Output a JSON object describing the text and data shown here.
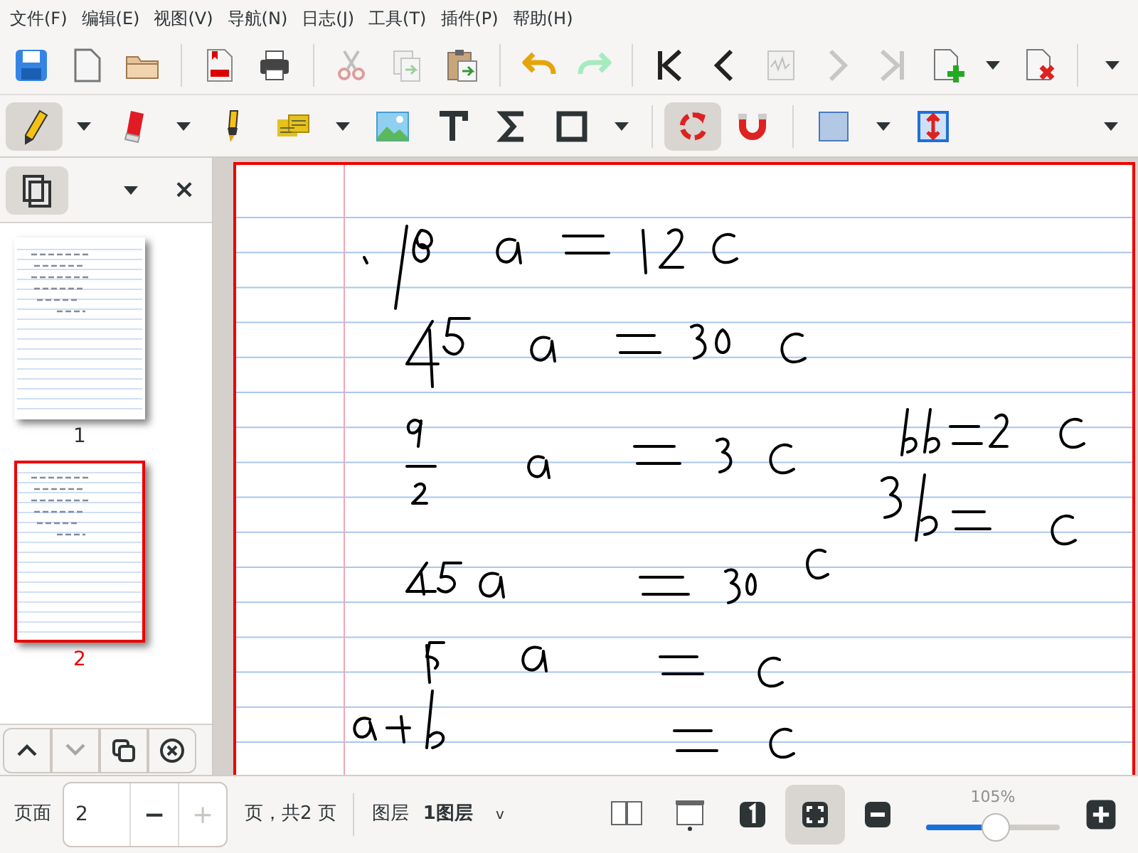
{
  "menu": [
    "文件(F)",
    "编辑(E)",
    "视图(V)",
    "导航(N)",
    "日志(J)",
    "工具(T)",
    "插件(P)",
    "帮助(H)"
  ],
  "toolbar_main": [
    {
      "kind": "save",
      "disabled": false
    },
    {
      "kind": "new",
      "disabled": false
    },
    {
      "kind": "open",
      "disabled": false
    },
    {
      "kind": "sep"
    },
    {
      "kind": "pdf",
      "disabled": false
    },
    {
      "kind": "print",
      "disabled": false
    },
    {
      "kind": "sep"
    },
    {
      "kind": "cut",
      "disabled": true
    },
    {
      "kind": "copy",
      "disabled": true
    },
    {
      "kind": "paste",
      "disabled": false
    },
    {
      "kind": "sep"
    },
    {
      "kind": "undo",
      "disabled": false
    },
    {
      "kind": "redo",
      "disabled": true
    },
    {
      "kind": "sep"
    },
    {
      "kind": "first",
      "disabled": false
    },
    {
      "kind": "prev",
      "disabled": false
    },
    {
      "kind": "goto",
      "disabled": true
    },
    {
      "kind": "next",
      "disabled": true
    },
    {
      "kind": "last",
      "disabled": true
    },
    {
      "kind": "addpage",
      "disabled": false
    },
    {
      "kind": "caret"
    },
    {
      "kind": "delpage",
      "disabled": false
    },
    {
      "kind": "sep"
    },
    {
      "kind": "overflow"
    }
  ],
  "toolbar_tools": [
    {
      "kind": "pencil",
      "selected": true
    },
    {
      "kind": "caret"
    },
    {
      "kind": "eraser",
      "selected": false
    },
    {
      "kind": "caret"
    },
    {
      "kind": "highlighter",
      "selected": false
    },
    {
      "kind": "textselect",
      "selected": false
    },
    {
      "kind": "caret"
    },
    {
      "kind": "image",
      "selected": false
    },
    {
      "kind": "text",
      "selected": false
    },
    {
      "kind": "sigma",
      "selected": false
    },
    {
      "kind": "rect",
      "selected": false
    },
    {
      "kind": "caret"
    },
    {
      "kind": "sep"
    },
    {
      "kind": "rotate",
      "selected": true
    },
    {
      "kind": "magnet",
      "selected": false
    },
    {
      "kind": "sep"
    },
    {
      "kind": "color",
      "selected": false
    },
    {
      "kind": "caret"
    },
    {
      "kind": "vspace",
      "selected": false
    },
    {
      "kind": "overflow"
    }
  ],
  "sidebar": {
    "close": "×",
    "pages": [
      {
        "label": "1",
        "selected": false
      },
      {
        "label": "2",
        "selected": true
      }
    ],
    "buttons": [
      {
        "kind": "up",
        "disabled": false
      },
      {
        "kind": "down",
        "disabled": true
      },
      {
        "kind": "duplicate",
        "disabled": false
      },
      {
        "kind": "delete",
        "disabled": false
      }
    ]
  },
  "status_bar": {
    "page_label": "页面",
    "page_value": "2",
    "minus": "−",
    "plus": "+",
    "plus_disabled": true,
    "page_total": "页，共2 页",
    "layer_label": "图层",
    "layer_value": "1图层",
    "layer_caret": "v",
    "view_buttons": [
      {
        "kind": "dual",
        "selected": false
      },
      {
        "kind": "presentation",
        "selected": false
      },
      {
        "kind": "one",
        "selected": false
      },
      {
        "kind": "fit",
        "selected": true
      },
      {
        "kind": "zoomout",
        "selected": false
      }
    ],
    "zoom": "105%",
    "zoom_slider": {
      "level": 0.52
    }
  }
}
